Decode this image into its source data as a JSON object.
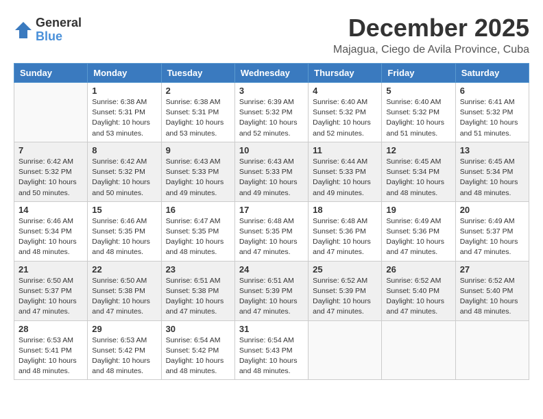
{
  "header": {
    "logo_general": "General",
    "logo_blue": "Blue",
    "month_title": "December 2025",
    "location": "Majagua, Ciego de Avila Province, Cuba"
  },
  "weekdays": [
    "Sunday",
    "Monday",
    "Tuesday",
    "Wednesday",
    "Thursday",
    "Friday",
    "Saturday"
  ],
  "weeks": [
    [
      {
        "day": "",
        "info": ""
      },
      {
        "day": "1",
        "info": "Sunrise: 6:38 AM\nSunset: 5:31 PM\nDaylight: 10 hours\nand 53 minutes."
      },
      {
        "day": "2",
        "info": "Sunrise: 6:38 AM\nSunset: 5:31 PM\nDaylight: 10 hours\nand 53 minutes."
      },
      {
        "day": "3",
        "info": "Sunrise: 6:39 AM\nSunset: 5:32 PM\nDaylight: 10 hours\nand 52 minutes."
      },
      {
        "day": "4",
        "info": "Sunrise: 6:40 AM\nSunset: 5:32 PM\nDaylight: 10 hours\nand 52 minutes."
      },
      {
        "day": "5",
        "info": "Sunrise: 6:40 AM\nSunset: 5:32 PM\nDaylight: 10 hours\nand 51 minutes."
      },
      {
        "day": "6",
        "info": "Sunrise: 6:41 AM\nSunset: 5:32 PM\nDaylight: 10 hours\nand 51 minutes."
      }
    ],
    [
      {
        "day": "7",
        "info": "Sunrise: 6:42 AM\nSunset: 5:32 PM\nDaylight: 10 hours\nand 50 minutes."
      },
      {
        "day": "8",
        "info": "Sunrise: 6:42 AM\nSunset: 5:32 PM\nDaylight: 10 hours\nand 50 minutes."
      },
      {
        "day": "9",
        "info": "Sunrise: 6:43 AM\nSunset: 5:33 PM\nDaylight: 10 hours\nand 49 minutes."
      },
      {
        "day": "10",
        "info": "Sunrise: 6:43 AM\nSunset: 5:33 PM\nDaylight: 10 hours\nand 49 minutes."
      },
      {
        "day": "11",
        "info": "Sunrise: 6:44 AM\nSunset: 5:33 PM\nDaylight: 10 hours\nand 49 minutes."
      },
      {
        "day": "12",
        "info": "Sunrise: 6:45 AM\nSunset: 5:34 PM\nDaylight: 10 hours\nand 48 minutes."
      },
      {
        "day": "13",
        "info": "Sunrise: 6:45 AM\nSunset: 5:34 PM\nDaylight: 10 hours\nand 48 minutes."
      }
    ],
    [
      {
        "day": "14",
        "info": "Sunrise: 6:46 AM\nSunset: 5:34 PM\nDaylight: 10 hours\nand 48 minutes."
      },
      {
        "day": "15",
        "info": "Sunrise: 6:46 AM\nSunset: 5:35 PM\nDaylight: 10 hours\nand 48 minutes."
      },
      {
        "day": "16",
        "info": "Sunrise: 6:47 AM\nSunset: 5:35 PM\nDaylight: 10 hours\nand 48 minutes."
      },
      {
        "day": "17",
        "info": "Sunrise: 6:48 AM\nSunset: 5:35 PM\nDaylight: 10 hours\nand 47 minutes."
      },
      {
        "day": "18",
        "info": "Sunrise: 6:48 AM\nSunset: 5:36 PM\nDaylight: 10 hours\nand 47 minutes."
      },
      {
        "day": "19",
        "info": "Sunrise: 6:49 AM\nSunset: 5:36 PM\nDaylight: 10 hours\nand 47 minutes."
      },
      {
        "day": "20",
        "info": "Sunrise: 6:49 AM\nSunset: 5:37 PM\nDaylight: 10 hours\nand 47 minutes."
      }
    ],
    [
      {
        "day": "21",
        "info": "Sunrise: 6:50 AM\nSunset: 5:37 PM\nDaylight: 10 hours\nand 47 minutes."
      },
      {
        "day": "22",
        "info": "Sunrise: 6:50 AM\nSunset: 5:38 PM\nDaylight: 10 hours\nand 47 minutes."
      },
      {
        "day": "23",
        "info": "Sunrise: 6:51 AM\nSunset: 5:38 PM\nDaylight: 10 hours\nand 47 minutes."
      },
      {
        "day": "24",
        "info": "Sunrise: 6:51 AM\nSunset: 5:39 PM\nDaylight: 10 hours\nand 47 minutes."
      },
      {
        "day": "25",
        "info": "Sunrise: 6:52 AM\nSunset: 5:39 PM\nDaylight: 10 hours\nand 47 minutes."
      },
      {
        "day": "26",
        "info": "Sunrise: 6:52 AM\nSunset: 5:40 PM\nDaylight: 10 hours\nand 47 minutes."
      },
      {
        "day": "27",
        "info": "Sunrise: 6:52 AM\nSunset: 5:40 PM\nDaylight: 10 hours\nand 48 minutes."
      }
    ],
    [
      {
        "day": "28",
        "info": "Sunrise: 6:53 AM\nSunset: 5:41 PM\nDaylight: 10 hours\nand 48 minutes."
      },
      {
        "day": "29",
        "info": "Sunrise: 6:53 AM\nSunset: 5:42 PM\nDaylight: 10 hours\nand 48 minutes."
      },
      {
        "day": "30",
        "info": "Sunrise: 6:54 AM\nSunset: 5:42 PM\nDaylight: 10 hours\nand 48 minutes."
      },
      {
        "day": "31",
        "info": "Sunrise: 6:54 AM\nSunset: 5:43 PM\nDaylight: 10 hours\nand 48 minutes."
      },
      {
        "day": "",
        "info": ""
      },
      {
        "day": "",
        "info": ""
      },
      {
        "day": "",
        "info": ""
      }
    ]
  ]
}
